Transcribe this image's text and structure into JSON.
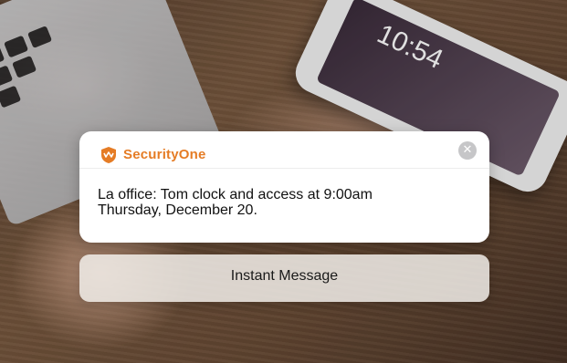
{
  "notification": {
    "app_name": "SecurityOne",
    "app_icon": "shield-logo-icon",
    "close_icon": "close-icon",
    "message_line1": "La office: Tom clock and access at 9:00am",
    "message_line2": "Thursday, December 20."
  },
  "action": {
    "label": "Instant Message"
  },
  "background": {
    "phone_time": "10:54"
  },
  "colors": {
    "brand": "#E57C25",
    "card": "#FFFFFF",
    "close_button": "#C6C6C8"
  }
}
